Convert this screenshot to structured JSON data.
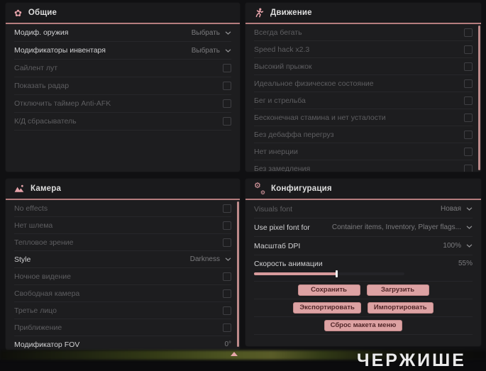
{
  "colors": {
    "accent_pink": "#e7a3aa",
    "header_underline": "#b57d7e",
    "button_bg": "#dda2a3",
    "button_text": "#512628",
    "scrollbar_pink": "#bd8a8a",
    "panel_bg": "#1d1d1f",
    "slider_fill": "#d89b9c"
  },
  "watermark": "ЧЕРЖИШЕ",
  "panels": [
    {
      "title": "Общие",
      "icon": "flower-icon",
      "rows": [
        {
          "label": "Модиф. оружия",
          "type": "dropdown",
          "value": "Выбрать",
          "bright": true
        },
        {
          "label": "Модификаторы инвентаря",
          "type": "dropdown",
          "value": "Выбрать",
          "bright": true
        },
        {
          "label": "Сайлент лут",
          "type": "checkbox",
          "checked": false
        },
        {
          "label": "Показать радар",
          "type": "checkbox",
          "checked": false
        },
        {
          "label": "Отключить таймер Anti-AFK",
          "type": "checkbox",
          "checked": false
        },
        {
          "label": "К/Д сбрасыватель",
          "type": "checkbox",
          "checked": false
        }
      ]
    },
    {
      "title": "Движение",
      "icon": "runner-icon",
      "scrollbar": true,
      "rows": [
        {
          "label": "Всегда бегать",
          "type": "checkbox",
          "checked": false
        },
        {
          "label": "Speed hack x2.3",
          "type": "checkbox",
          "checked": false
        },
        {
          "label": "Высокий прыжок",
          "type": "checkbox",
          "checked": false
        },
        {
          "label": "Идеальное физическое состояние",
          "type": "checkbox",
          "checked": false
        },
        {
          "label": "Бег и стрельба",
          "type": "checkbox",
          "checked": false
        },
        {
          "label": "Бесконечная стамина и нет усталости",
          "type": "checkbox",
          "checked": false
        },
        {
          "label": "Без дебаффа перегруз",
          "type": "checkbox",
          "checked": false
        },
        {
          "label": "Нет инерции",
          "type": "checkbox",
          "checked": false
        },
        {
          "label": "Без замедления",
          "type": "checkbox",
          "checked": false
        }
      ]
    },
    {
      "title": "Камера",
      "icon": "mountains-icon",
      "scrollbar": true,
      "rows": [
        {
          "label": "No effects",
          "type": "checkbox",
          "checked": false
        },
        {
          "label": "Нет шлема",
          "type": "checkbox",
          "checked": false
        },
        {
          "label": "Тепловое зрение",
          "type": "checkbox",
          "checked": false
        },
        {
          "label": "Style",
          "type": "dropdown",
          "value": "Darkness",
          "bright": true
        },
        {
          "label": "Ночное видение",
          "type": "checkbox",
          "checked": false
        },
        {
          "label": "Свободная камера",
          "type": "checkbox",
          "checked": false
        },
        {
          "label": "Третье лицо",
          "type": "checkbox",
          "checked": false
        },
        {
          "label": "Приближение",
          "type": "checkbox",
          "checked": false
        },
        {
          "label": "Модификатор FOV",
          "type": "slider",
          "value": "0°",
          "percent": 0,
          "bright": true,
          "track": "full"
        }
      ]
    },
    {
      "title": "Конфигурация",
      "icon": "gears-icon",
      "rows": [
        {
          "label": "Visuals font",
          "type": "dropdown",
          "value": "Новая"
        },
        {
          "label": "Use pixel font for",
          "type": "dropdown",
          "value": "Container items, Inventory, Player flags...",
          "bright": true
        },
        {
          "label": "Масштаб DPI",
          "type": "dropdown",
          "value": "100%",
          "bright": true
        },
        {
          "label": "Скорость анимации",
          "type": "slider",
          "value": "55%",
          "percent": 55,
          "bright": true,
          "track": "narrow"
        }
      ],
      "buttons": [
        [
          "Сохранить",
          "Загрузить"
        ],
        [
          "Экспортировать",
          "Импортировать"
        ]
      ],
      "reset_label": "Сброс макета меню"
    }
  ]
}
